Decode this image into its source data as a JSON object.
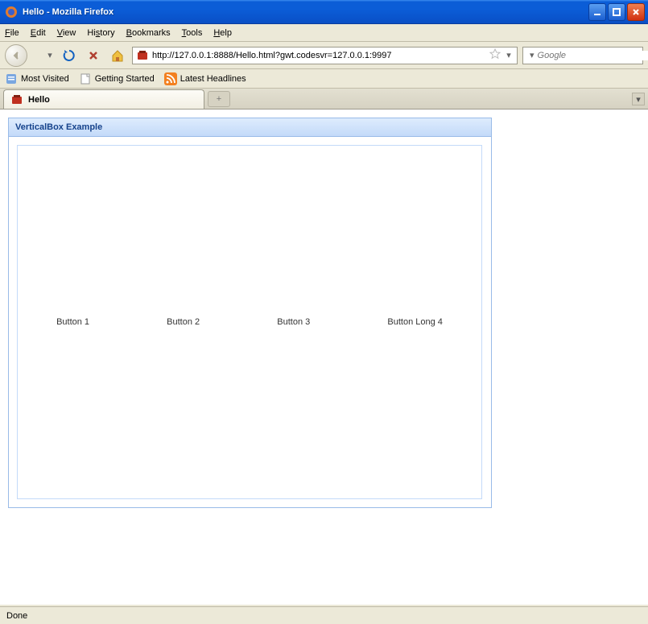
{
  "window": {
    "title": "Hello - Mozilla Firefox"
  },
  "menu": {
    "file": "File",
    "edit": "Edit",
    "view": "View",
    "history": "History",
    "bookmarks": "Bookmarks",
    "tools": "Tools",
    "help": "Help"
  },
  "nav": {
    "url": "http://127.0.0.1:8888/Hello.html?gwt.codesvr=127.0.0.1:9997",
    "search_placeholder": "Google"
  },
  "bookmarks": {
    "most_visited": "Most Visited",
    "getting_started": "Getting Started",
    "latest_headlines": "Latest Headlines"
  },
  "tabs": {
    "active": "Hello",
    "newtab_glyph": "+"
  },
  "page": {
    "panel_title": "VerticalBox Example",
    "buttons": [
      "Button 1",
      "Button 2",
      "Button 3",
      "Button Long 4"
    ]
  },
  "status": {
    "text": "Done"
  }
}
